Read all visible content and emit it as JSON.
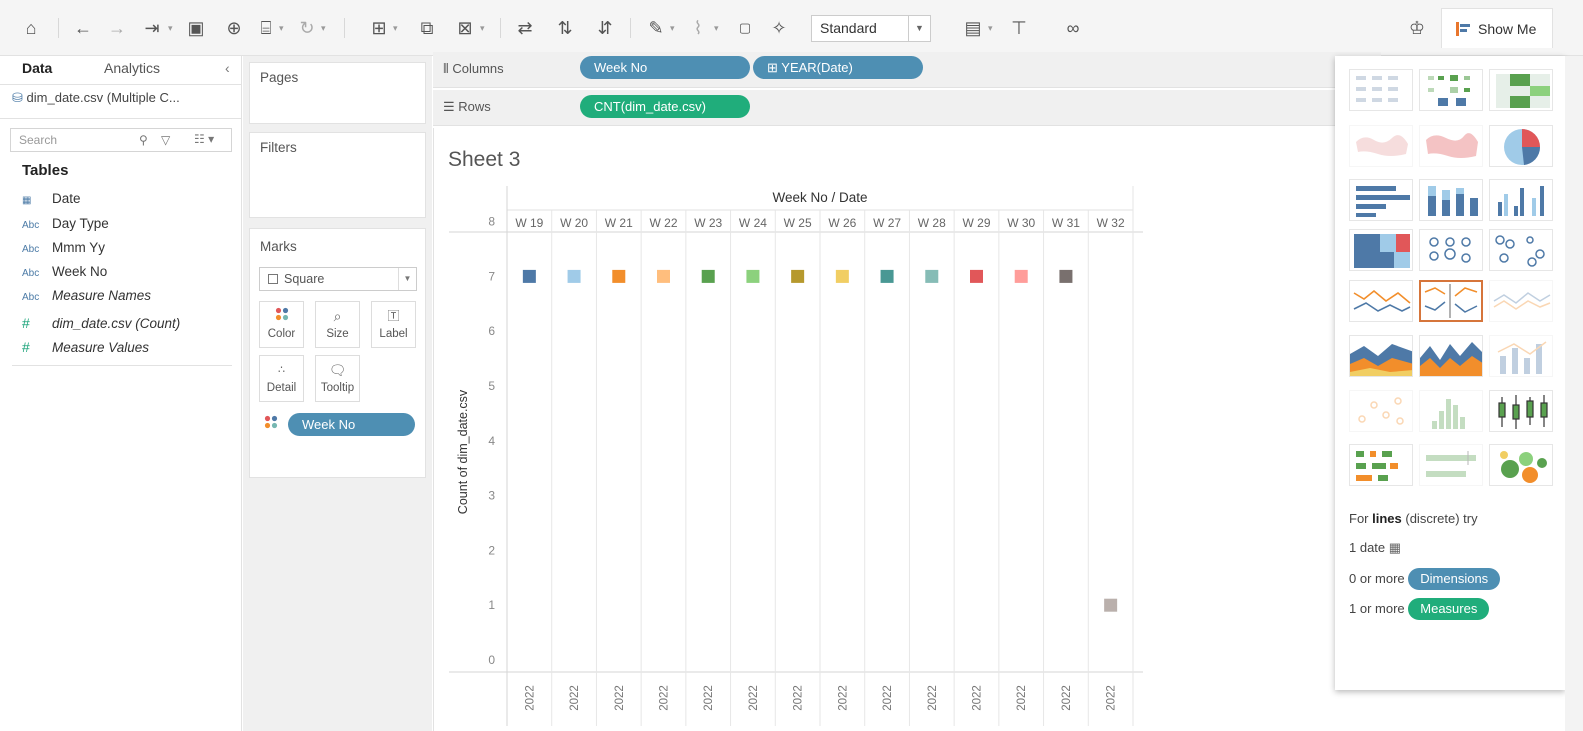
{
  "toolbar": {
    "standard_label": "Standard",
    "show_me_label": "Show Me"
  },
  "data_pane": {
    "tabs": [
      "Data",
      "Analytics"
    ],
    "datasource": "dim_date.csv (Multiple C...",
    "search_placeholder": "Search",
    "tables_heading": "Tables",
    "fields": [
      {
        "type": "date",
        "type_glyph": "📅",
        "name": "Date",
        "italic": false
      },
      {
        "type": "abc",
        "type_glyph": "Abc",
        "name": "Day Type",
        "italic": false
      },
      {
        "type": "abc",
        "type_glyph": "Abc",
        "name": "Mmm Yy",
        "italic": false
      },
      {
        "type": "abc",
        "type_glyph": "Abc",
        "name": "Week No",
        "italic": false
      },
      {
        "type": "abc",
        "type_glyph": "Abc",
        "name": "Measure Names",
        "italic": true
      }
    ],
    "measures": [
      {
        "type_glyph": "#",
        "name": "dim_date.csv (Count)",
        "italic": true
      },
      {
        "type_glyph": "#",
        "name": "Measure Values",
        "italic": true
      }
    ]
  },
  "cards": {
    "pages": "Pages",
    "filters": "Filters",
    "marks": "Marks"
  },
  "marks": {
    "type": "Square",
    "buttons": {
      "color": "Color",
      "size": "Size",
      "label": "Label",
      "detail": "Detail",
      "tooltip": "Tooltip"
    },
    "pill": "Week No"
  },
  "shelves": {
    "columns_label": "Columns",
    "rows_label": "Rows",
    "columns_pills": [
      "Week No",
      "⊞ YEAR(Date)"
    ],
    "rows_pill": "CNT(dim_date.csv)"
  },
  "sheet": {
    "title": "Sheet 3"
  },
  "chart_data": {
    "type": "scatter",
    "mark": "square",
    "header_title": "Week No / Date",
    "categories": [
      "W 19",
      "W 20",
      "W 21",
      "W 22",
      "W 23",
      "W 24",
      "W 25",
      "W 26",
      "W 27",
      "W 28",
      "W 29",
      "W 30",
      "W 31",
      "W 32"
    ],
    "year_labels": [
      "2022",
      "2022",
      "2022",
      "2022",
      "2022",
      "2022",
      "2022",
      "2022",
      "2022",
      "2022",
      "2022",
      "2022",
      "2022",
      "2022"
    ],
    "values": [
      7,
      7,
      7,
      7,
      7,
      7,
      7,
      7,
      7,
      7,
      7,
      7,
      7,
      1
    ],
    "colors": [
      "#4e79a7",
      "#a0cbe8",
      "#f28e2b",
      "#ffbe7d",
      "#59a14f",
      "#8cd17d",
      "#b6992d",
      "#f1ce63",
      "#499894",
      "#86bcb6",
      "#e15759",
      "#ff9d9a",
      "#79706e",
      "#bab0ac"
    ],
    "ylabel": "Count of dim_date.csv",
    "yticks": [
      0,
      1,
      2,
      3,
      4,
      5,
      6,
      7,
      8
    ],
    "ylim": [
      0,
      8.3
    ],
    "grid": false
  },
  "show_me": {
    "hint_prefix": "For",
    "hint_bold": "lines",
    "hint_suffix": "(discrete) try",
    "req1": "1 date",
    "req2_prefix": "0 or more",
    "req2_pill": "Dimensions",
    "req3_prefix": "1 or more",
    "req3_pill": "Measures"
  }
}
